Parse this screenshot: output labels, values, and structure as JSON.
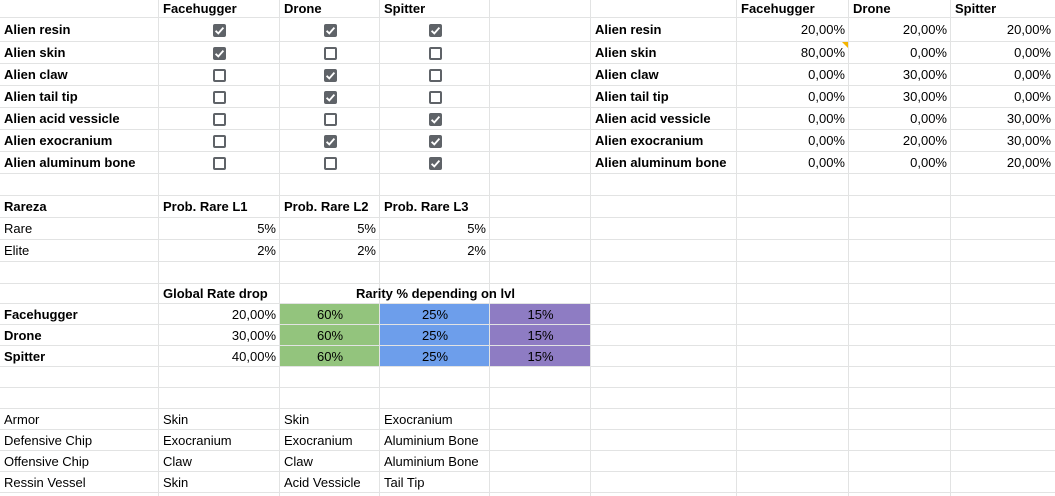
{
  "colors": {
    "green": "#93c47d",
    "blue": "#6d9eeb",
    "purple": "#8e7cc3",
    "grid": "#e2e3e3",
    "note": "#f4b400"
  },
  "left_table": {
    "headers": [
      "Facehugger",
      "Drone",
      "Spitter"
    ],
    "rows": [
      {
        "label": "Alien resin",
        "checks": [
          true,
          true,
          true
        ]
      },
      {
        "label": "Alien skin",
        "checks": [
          true,
          false,
          false
        ]
      },
      {
        "label": "Alien claw",
        "checks": [
          false,
          true,
          false
        ]
      },
      {
        "label": "Alien tail tip",
        "checks": [
          false,
          true,
          false
        ]
      },
      {
        "label": "Alien acid vessicle",
        "checks": [
          false,
          false,
          true
        ]
      },
      {
        "label": "Alien exocranium",
        "checks": [
          false,
          true,
          true
        ]
      },
      {
        "label": "Alien aluminum bone",
        "checks": [
          false,
          false,
          true
        ]
      }
    ]
  },
  "right_table": {
    "headers": [
      "Facehugger",
      "Drone",
      "Spitter"
    ],
    "rows": [
      {
        "label": "Alien resin",
        "values": [
          "20,00%",
          "20,00%",
          "20,00%"
        ]
      },
      {
        "label": "Alien skin",
        "values": [
          "80,00%",
          "0,00%",
          "0,00%"
        ]
      },
      {
        "label": "Alien claw",
        "values": [
          "0,00%",
          "30,00%",
          "0,00%"
        ]
      },
      {
        "label": "Alien tail tip",
        "values": [
          "0,00%",
          "30,00%",
          "0,00%"
        ]
      },
      {
        "label": "Alien acid vessicle",
        "values": [
          "0,00%",
          "0,00%",
          "30,00%"
        ]
      },
      {
        "label": "Alien exocranium",
        "values": [
          "0,00%",
          "20,00%",
          "30,00%"
        ]
      },
      {
        "label": "Alien aluminum bone",
        "values": [
          "0,00%",
          "0,00%",
          "20,00%"
        ]
      }
    ]
  },
  "rarity_table": {
    "title": "Rareza",
    "headers": [
      "Prob. Rare L1",
      "Prob. Rare L2",
      "Prob. Rare L3"
    ],
    "rows": [
      {
        "label": "Rare",
        "values": [
          "5%",
          "5%",
          "5%"
        ]
      },
      {
        "label": "Elite",
        "values": [
          "2%",
          "2%",
          "2%"
        ]
      }
    ]
  },
  "drop_table": {
    "header_rate": "Global Rate drop",
    "header_rarity": "Rarity % depending on lvl",
    "rows": [
      {
        "label": "Facehugger",
        "rate": "20,00%",
        "levels": [
          "60%",
          "25%",
          "15%"
        ]
      },
      {
        "label": "Drone",
        "rate": "30,00%",
        "levels": [
          "60%",
          "25%",
          "15%"
        ]
      },
      {
        "label": "Spitter",
        "rate": "40,00%",
        "levels": [
          "60%",
          "25%",
          "15%"
        ]
      }
    ]
  },
  "items_table": {
    "rows": [
      {
        "label": "Armor",
        "values": [
          "Skin",
          "Skin",
          "Exocranium"
        ]
      },
      {
        "label": "Defensive Chip",
        "values": [
          "Exocranium",
          "Exocranium",
          "Aluminium Bone"
        ]
      },
      {
        "label": "Offensive Chip",
        "values": [
          "Claw",
          "Claw",
          "Aluminium Bone"
        ]
      },
      {
        "label": "Ressin Vessel",
        "values": [
          "Skin",
          "Acid Vessicle",
          "Tail Tip"
        ]
      }
    ]
  }
}
